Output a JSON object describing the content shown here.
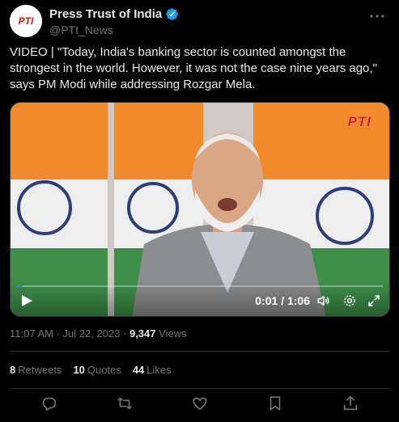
{
  "author": {
    "name": "Press Trust of India",
    "handle": "@PTI_News",
    "avatar_text": "PTI",
    "verified": true
  },
  "tweet": {
    "text": "VIDEO | \"Today, India's banking sector is counted amongst the strongest in the world. However, it was not the case nine years ago,\" says PM Modi while addressing Rozgar Mela."
  },
  "video": {
    "watermark": "PTI",
    "current_time": "0:01 / 1:06",
    "progress": 0.015
  },
  "meta": {
    "time": "11:07 AM",
    "date": "Jul 22, 2023",
    "views_count": "9,347",
    "views_label": "Views"
  },
  "stats": {
    "retweets_count": "8",
    "retweets_label": "Retweets",
    "quotes_count": "10",
    "quotes_label": "Quotes",
    "likes_count": "44",
    "likes_label": "Likes"
  },
  "colors": {
    "background": "#000000",
    "text": "#e7e9ea",
    "muted": "#71767b",
    "accent": "#1d9bf0",
    "border": "#2f3336"
  },
  "icons": [
    "verified-badge-icon",
    "more-icon",
    "play-icon",
    "volume-icon",
    "settings-icon",
    "fullscreen-icon",
    "reply-icon",
    "retweet-icon",
    "like-icon",
    "bookmark-icon",
    "share-icon"
  ]
}
